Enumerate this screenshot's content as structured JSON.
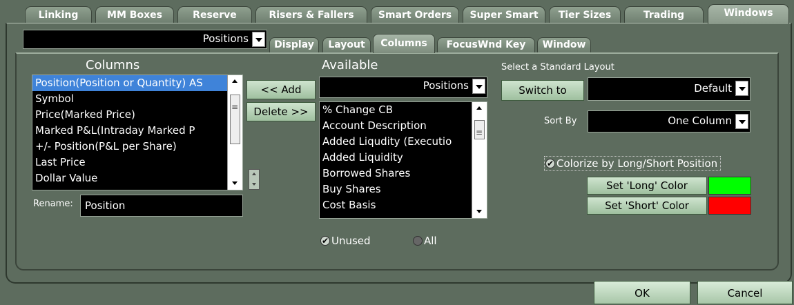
{
  "top_tabs": [
    "Linking",
    "MM Boxes",
    "Reserve",
    "Risers & Fallers",
    "Smart Orders",
    "Super Smart",
    "Tier Sizes",
    "Trading",
    "Windows"
  ],
  "active_top_tab": "Windows",
  "window_select": {
    "value": "Positions"
  },
  "sub_tabs": [
    "Display",
    "Layout",
    "Columns",
    "FocusWnd Key",
    "Window"
  ],
  "active_sub_tab": "Columns",
  "columns": {
    "title": "Columns",
    "items": [
      "Position(Position or Quantity) AS",
      "Symbol",
      "Price(Marked Price)",
      "Marked P&L(Intraday Marked P",
      "+/- Position(P&L per Share)",
      "Last Price",
      "Dollar Value"
    ],
    "selected_index": 0
  },
  "buttons": {
    "add": "<< Add",
    "delete": "Delete >>",
    "switch_to": "Switch to",
    "set_long": "Set 'Long' Color",
    "set_short": "Set 'Short' Color",
    "ok": "OK",
    "cancel": "Cancel"
  },
  "rename": {
    "label": "Rename:",
    "value": "Position"
  },
  "available": {
    "title": "Available",
    "select_value": "Positions",
    "items": [
      "% Change CB",
      "Account Description",
      "Added Liqudity (Executio",
      "Added Liquidity",
      "Borrowed Shares",
      "Buy Shares",
      "Cost Basis"
    ]
  },
  "filter": {
    "unused": "Unused",
    "all": "All",
    "selected": "Unused"
  },
  "standard_layout": {
    "label": "Select a Standard Layout",
    "value": "Default"
  },
  "sort_by": {
    "label": "Sort By",
    "value": "One Column"
  },
  "colorize": {
    "label": "Colorize by Long/Short Position",
    "checked": true
  },
  "colors": {
    "long": "#00ff00",
    "short": "#ff0000",
    "accent": "#3f83d9",
    "panel": "#5d6c5e"
  }
}
